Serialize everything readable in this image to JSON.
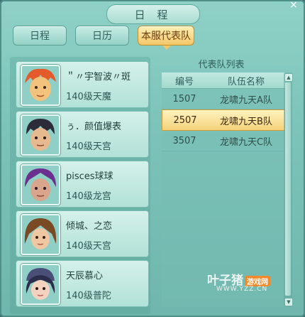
{
  "window": {
    "title": "日 程",
    "close_glyph": "×"
  },
  "tabs": [
    {
      "label": "日程",
      "active": false
    },
    {
      "label": "日历",
      "active": false
    },
    {
      "label": "本服代表队",
      "active": true
    }
  ],
  "members": [
    {
      "name": "＂〃宇智波〃斑",
      "level": "140级天魔",
      "avatar_colors": [
        "#e55a2b",
        "#f3c27c"
      ]
    },
    {
      "name": "ぅ．颜值爆表",
      "level": "140级天宫",
      "avatar_colors": [
        "#2b2b3a",
        "#e7b98f"
      ]
    },
    {
      "name": "pisces球球",
      "level": "140级龙宫",
      "avatar_colors": [
        "#6a2f8f",
        "#d9a58c"
      ]
    },
    {
      "name": "倾城、之恋",
      "level": "140级天宫",
      "avatar_colors": [
        "#7a4a24",
        "#f0c7a3"
      ]
    },
    {
      "name": "天辰慕心",
      "level": "140级普陀",
      "avatar_colors": [
        "#2b2e4a",
        "#f3d3bf"
      ]
    }
  ],
  "team_list": {
    "title": "代表队列表",
    "headers": {
      "id": "编号",
      "name": "队伍名称"
    },
    "rows": [
      {
        "id": "1507",
        "name": "龙啸九天A队",
        "selected": false
      },
      {
        "id": "2507",
        "name": "龙啸九天B队",
        "selected": true
      },
      {
        "id": "3507",
        "name": "龙啸九天C队",
        "selected": false
      }
    ],
    "scroll_up_glyph": "▲",
    "scroll_down_glyph": "▼"
  },
  "watermark": {
    "text": "叶子猪",
    "badge": "游戏网",
    "url": "WWW.YZZ.CN"
  }
}
